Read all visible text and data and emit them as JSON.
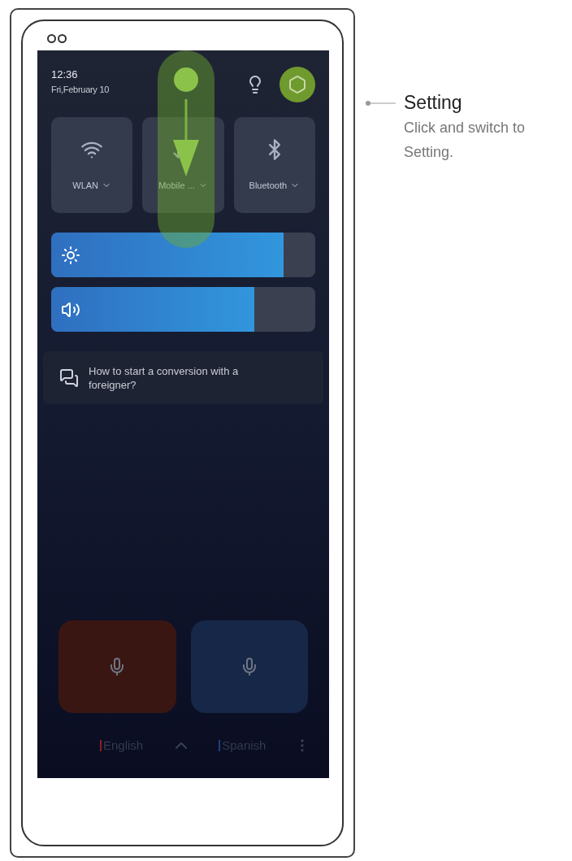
{
  "screen": {
    "time": "12:36",
    "date": "Fri,February 10",
    "settings_highlighted": true,
    "gesture_hint": true,
    "tiles": [
      {
        "kind": "wifi",
        "label": "WLAN"
      },
      {
        "kind": "mobile",
        "label": "Mobile ..."
      },
      {
        "kind": "bluetooth",
        "label": "Bluetooth"
      }
    ],
    "sliders": [
      {
        "kind": "brightness",
        "level": 0.88
      },
      {
        "kind": "volume",
        "level": 0.77
      }
    ],
    "tip": "How to start a conversion with a foreigner?",
    "mic_buttons": [
      {
        "color": "#3a1612"
      },
      {
        "color": "#162748"
      }
    ],
    "languages": [
      {
        "label": "English",
        "color": "#8a1f1f"
      },
      {
        "label": "Spanish",
        "color": "#1f3f7a"
      }
    ]
  },
  "callout": {
    "title": "Setting",
    "description": "Click and switch to Setting."
  }
}
